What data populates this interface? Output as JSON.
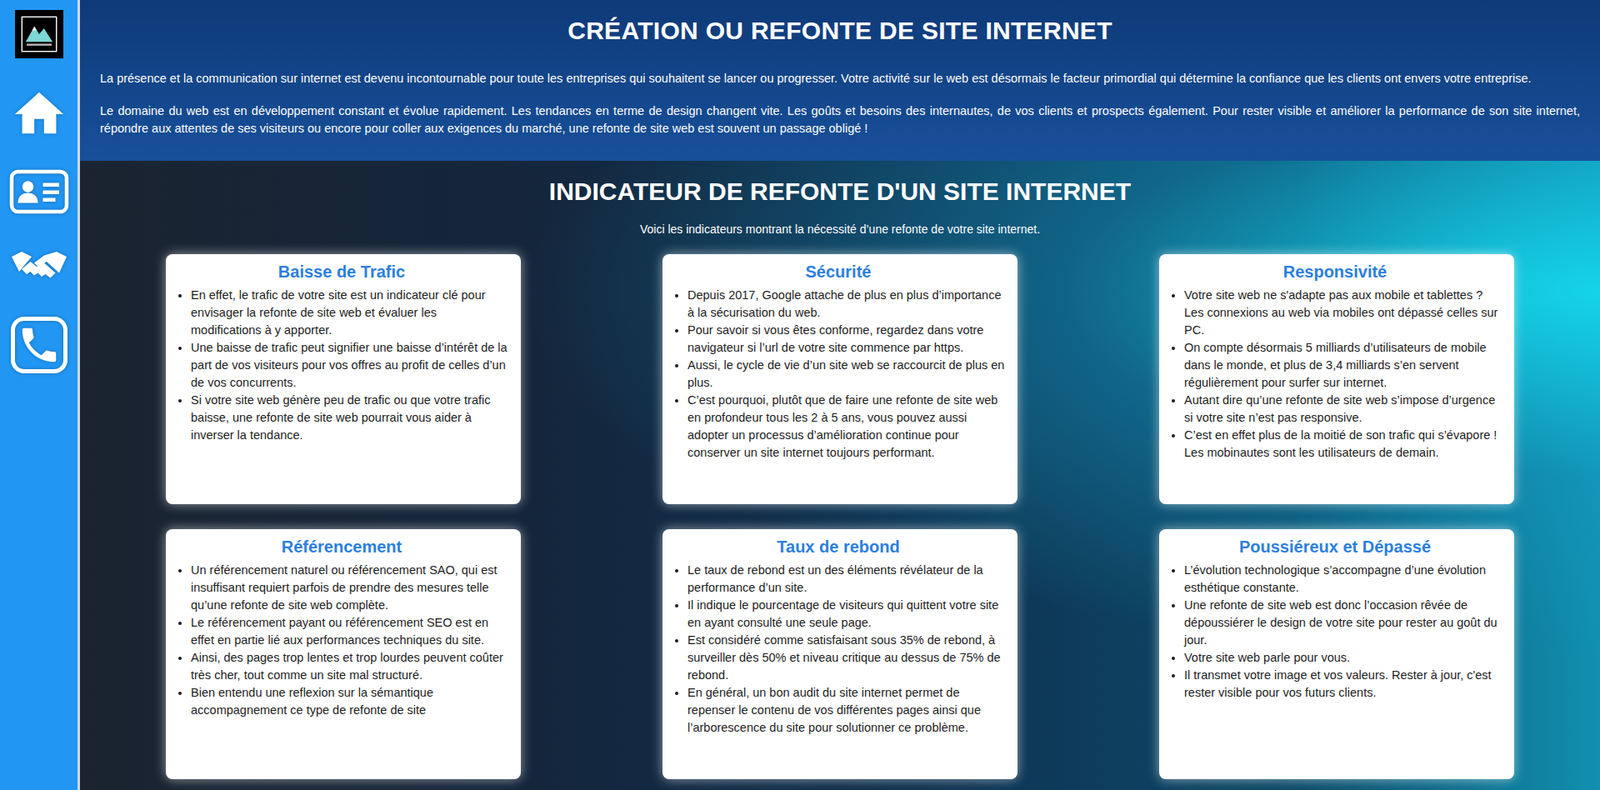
{
  "header": {
    "title": "CRÉATION OU REFONTE DE SITE INTERNET",
    "paragraphs": [
      "La présence et la communication sur internet est devenu incontournable pour toute les entreprises qui souhaitent se lancer ou progresser. Votre activité sur le web est désormais le facteur primordial qui détermine la confiance que les clients ont envers votre entreprise.",
      "Le domaine du web est en développement constant et évolue rapidement. Les tendances en terme de design changent vite. Les goûts et besoins des internautes, de vos clients et prospects également. Pour rester visible et améliorer la performance de son site internet, répondre aux attentes de ses visiteurs ou encore pour coller aux exigences du marché, une refonte de site web est souvent un passage obligé !"
    ]
  },
  "indicators": {
    "title": "INDICATEUR DE REFONTE D'UN SITE INTERNET",
    "subtitle": "Voici les indicateurs montrant la nécessité d’une refonte de votre site internet.",
    "cards": [
      {
        "title": "Baisse de Trafic",
        "items": [
          "En effet, le trafic de votre site est un indicateur clé pour envisager la refonte de site web et évaluer les modifications à y apporter.",
          "Une baisse de trafic peut signifier une baisse d’intérêt de la part de vos visiteurs pour vos offres au profit de celles d’un de vos concurrents.",
          "Si votre site web génère peu de trafic ou que votre trafic baisse, une refonte de site web pourrait vous aider à inverser la tendance."
        ]
      },
      {
        "title": "Sécurité",
        "items": [
          "Depuis 2017, Google attache de plus en plus d’importance à la sécurisation du web.",
          "Pour savoir si vous êtes conforme, regardez dans votre navigateur si l’url de votre site commence par https.",
          "Aussi, le cycle de vie d’un site web se raccourcit de plus en plus.",
          "C’est pourquoi, plutôt que de faire une refonte de site web en profondeur tous les 2 à 5 ans, vous pouvez aussi adopter un processus d’amélioration continue pour conserver un site internet toujours performant."
        ]
      },
      {
        "title": "Responsivité",
        "items": [
          "Votre site web ne s'adapte pas aux mobile et tablettes ? Les connexions au web via mobiles ont dépassé celles sur PC.",
          "On compte désormais 5 milliards d’utilisateurs de mobile dans le monde, et plus de 3,4 milliards s’en servent régulièrement pour surfer sur internet.",
          "Autant dire qu’une refonte de site web s’impose d’urgence si votre site n’est pas responsive.",
          "C’est en effet plus de la moitié de son trafic qui s’évapore ! Les mobinautes sont les utilisateurs de demain."
        ]
      },
      {
        "title": "Référencement",
        "items": [
          "Un référencement naturel ou référencement SAO, qui est insuffisant requiert parfois de prendre des mesures telle qu’une refonte de site web complète.",
          "Le référencement payant ou référencement SEO est en effet en partie lié aux performances techniques du site.",
          "Ainsi, des pages trop lentes et trop lourdes peuvent coûter très cher, tout comme un site mal structuré.",
          "Bien entendu une reflexion sur la sémantique accompagnement ce type de refonte de site"
        ]
      },
      {
        "title": "Taux de rebond",
        "items": [
          "Le taux de rebond est un des éléments révélateur de la performance d’un site.",
          "Il indique le pourcentage de visiteurs qui quittent votre site en ayant consulté une seule page.",
          "Est considéré comme satisfaisant sous 35% de rebond, à surveiller dès 50% et niveau critique au dessus de 75% de rebond.",
          "En général, un bon audit du site internet permet de repenser le contenu de vos différentes pages ainsi que l’arborescence du site pour solutionner ce problème."
        ]
      },
      {
        "title": "Poussiéreux et Dépassé",
        "items": [
          "L’évolution technologique s’accompagne d’une évolution esthétique constante.",
          "Une refonte de site web est donc l’occasion rêvée de dépoussiérer le design de votre site pour rester au goût du jour.",
          "Votre site web parle pour vous.",
          "Il transmet votre image et vos valeurs. Rester à jour, c'est rester visible pour vos futurs clients."
        ]
      }
    ]
  }
}
